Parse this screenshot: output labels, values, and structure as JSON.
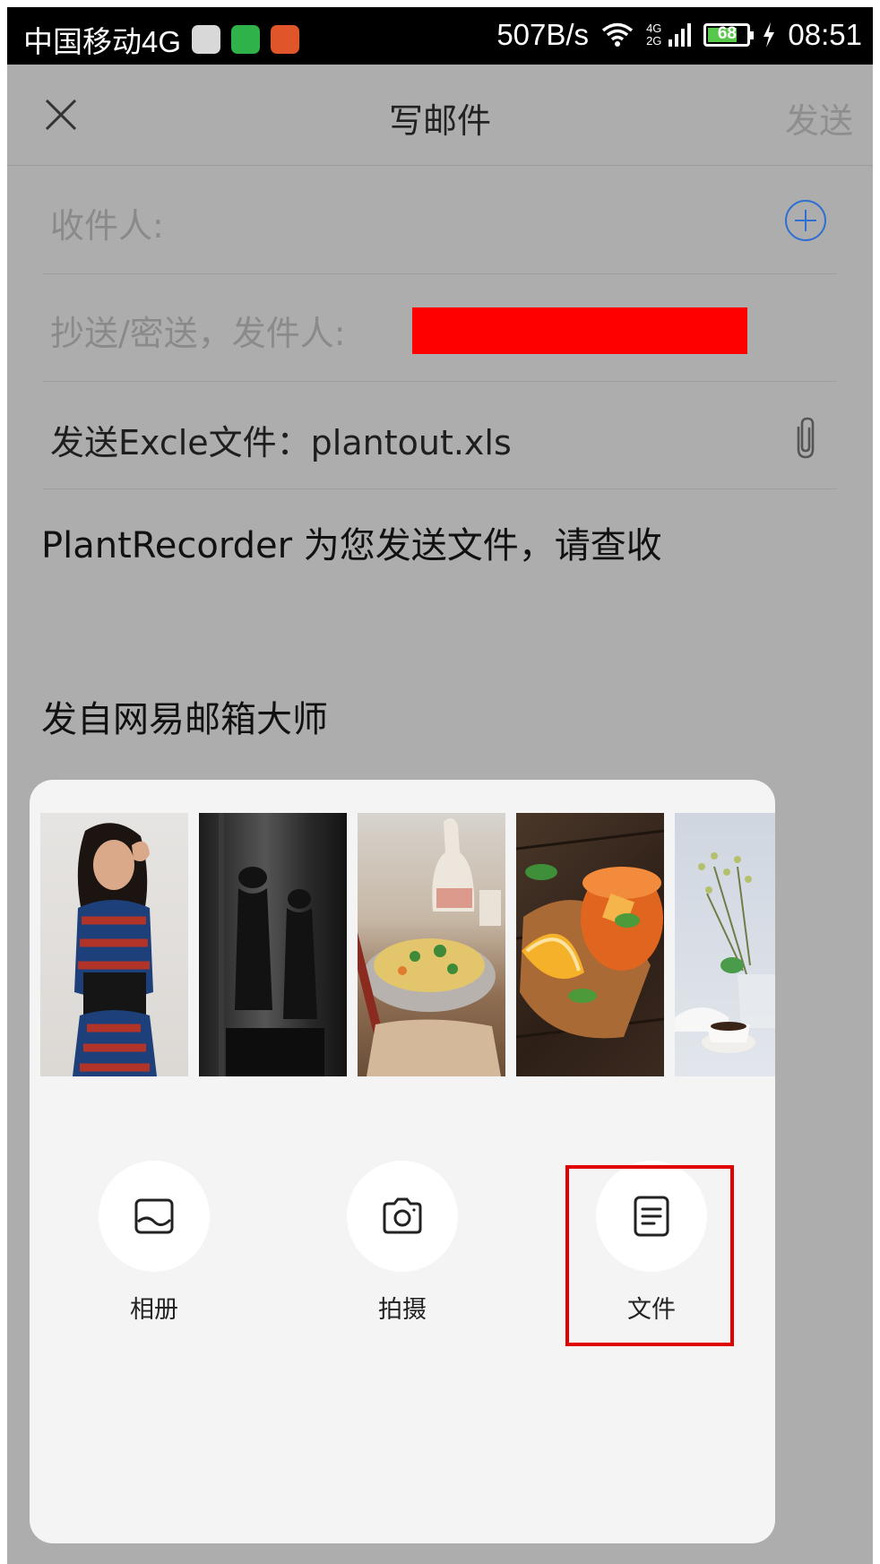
{
  "status_bar": {
    "carrier": "中国移动4G",
    "speed": "507B/s",
    "network": [
      "4G",
      "2G"
    ],
    "battery": "68",
    "time": "08:51",
    "app_icons": [
      "notes-app-icon",
      "green-app-icon",
      "health-app-icon"
    ]
  },
  "header": {
    "title": "写邮件",
    "send_label": "发送"
  },
  "compose": {
    "to_label": "收件人:",
    "cc_label": "抄送/密送，发件人:",
    "subject": "发送Excle文件：plantout.xls",
    "body_line1": "PlantRecorder 为您发送文件，请查收",
    "signature": "发自网易邮箱大师"
  },
  "attach_sheet": {
    "photos": [
      "photo-woman-portrait",
      "photo-shadows-bw",
      "photo-noodle-bowl",
      "photo-iced-tea",
      "photo-flowers"
    ],
    "actions": [
      {
        "label": "相册",
        "icon": "album-icon"
      },
      {
        "label": "拍摄",
        "icon": "camera-icon"
      },
      {
        "label": "文件",
        "icon": "file-icon"
      }
    ]
  },
  "colors": {
    "accent": "#2f6fd1",
    "overlay": "#adadad",
    "highlight": "#e00000",
    "redaction": "#ff0000"
  }
}
